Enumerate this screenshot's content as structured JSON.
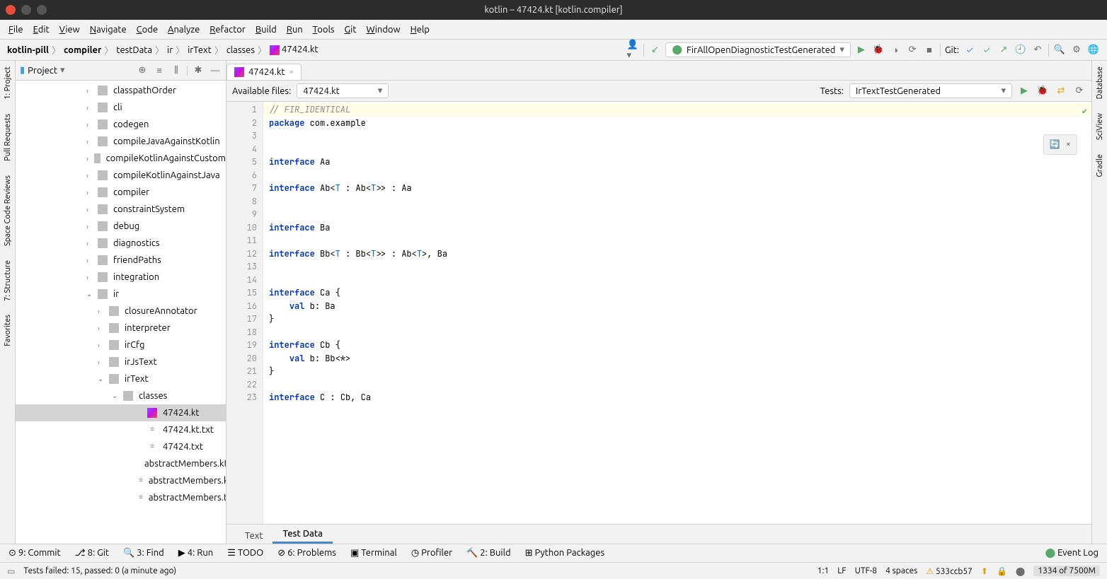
{
  "window": {
    "title": "kotlin – 47424.kt [kotlin.compiler]"
  },
  "menu": [
    "File",
    "Edit",
    "View",
    "Navigate",
    "Code",
    "Analyze",
    "Refactor",
    "Build",
    "Run",
    "Tools",
    "Git",
    "Window",
    "Help"
  ],
  "breadcrumbs": [
    "kotlin-pill",
    "compiler",
    "testData",
    "ir",
    "irText",
    "classes",
    "47424.kt"
  ],
  "run_config": "FirAllOpenDiagnosticTestGenerated",
  "git_label": "Git:",
  "left_tools": [
    {
      "label": "1: Project",
      "icon": "project-icon"
    },
    {
      "label": "Pull Requests",
      "icon": "pr-icon"
    },
    {
      "label": "Space Code Reviews",
      "icon": "space-icon"
    },
    {
      "label": "7: Structure",
      "icon": "structure-icon"
    },
    {
      "label": "Favorites",
      "icon": "star-icon"
    }
  ],
  "right_tools": [
    {
      "label": "Database",
      "icon": "database-icon"
    },
    {
      "label": "SciView",
      "icon": "sciview-icon"
    },
    {
      "label": "Gradle",
      "icon": "gradle-icon"
    }
  ],
  "project_tree": {
    "title": "Project",
    "items": [
      {
        "label": "classpathOrder",
        "indent": 1,
        "chev": "›",
        "icon": "folder"
      },
      {
        "label": "cli",
        "indent": 1,
        "chev": "›",
        "icon": "folder"
      },
      {
        "label": "codegen",
        "indent": 1,
        "chev": "›",
        "icon": "folder"
      },
      {
        "label": "compileJavaAgainstKotlin",
        "indent": 1,
        "chev": "›",
        "icon": "folder"
      },
      {
        "label": "compileKotlinAgainstCustom",
        "indent": 1,
        "chev": "›",
        "icon": "folder"
      },
      {
        "label": "compileKotlinAgainstJava",
        "indent": 1,
        "chev": "›",
        "icon": "folder"
      },
      {
        "label": "compiler",
        "indent": 1,
        "chev": "›",
        "icon": "folder"
      },
      {
        "label": "constraintSystem",
        "indent": 1,
        "chev": "›",
        "icon": "folder"
      },
      {
        "label": "debug",
        "indent": 1,
        "chev": "›",
        "icon": "folder"
      },
      {
        "label": "diagnostics",
        "indent": 1,
        "chev": "›",
        "icon": "folder"
      },
      {
        "label": "friendPaths",
        "indent": 1,
        "chev": "›",
        "icon": "folder"
      },
      {
        "label": "integration",
        "indent": 1,
        "chev": "›",
        "icon": "folder"
      },
      {
        "label": "ir",
        "indent": 1,
        "chev": "⌄",
        "icon": "folder"
      },
      {
        "label": "closureAnnotator",
        "indent": 2,
        "chev": "›",
        "icon": "folder"
      },
      {
        "label": "interpreter",
        "indent": 2,
        "chev": "›",
        "icon": "folder"
      },
      {
        "label": "irCfg",
        "indent": 2,
        "chev": "›",
        "icon": "folder"
      },
      {
        "label": "irJsText",
        "indent": 2,
        "chev": "›",
        "icon": "folder"
      },
      {
        "label": "irText",
        "indent": 2,
        "chev": "⌄",
        "icon": "folder"
      },
      {
        "label": "classes",
        "indent": 3,
        "chev": "⌄",
        "icon": "folder"
      },
      {
        "label": "47424.kt",
        "indent": 5,
        "chev": "",
        "icon": "kt",
        "selected": true
      },
      {
        "label": "47424.kt.txt",
        "indent": 5,
        "chev": "",
        "icon": "txt"
      },
      {
        "label": "47424.txt",
        "indent": 5,
        "chev": "",
        "icon": "txt"
      },
      {
        "label": "abstractMembers.kt",
        "indent": 5,
        "chev": "",
        "icon": "kt"
      },
      {
        "label": "abstractMembers.kt.",
        "indent": 5,
        "chev": "",
        "icon": "txt"
      },
      {
        "label": "abstractMembers.tx",
        "indent": 5,
        "chev": "",
        "icon": "txt"
      }
    ]
  },
  "editor": {
    "tab_label": "47424.kt",
    "available_label": "Available files:",
    "available_value": "47424.kt",
    "tests_label": "Tests:",
    "tests_value": "IrTextTestGenerated",
    "lines": [
      {
        "n": 1,
        "segs": [
          {
            "t": "// FIR_IDENTICAL",
            "c": "comment"
          }
        ],
        "hl": true
      },
      {
        "n": 2,
        "segs": [
          {
            "t": "package",
            "c": "kw"
          },
          {
            "t": " com.example"
          }
        ]
      },
      {
        "n": 3,
        "segs": []
      },
      {
        "n": 4,
        "segs": []
      },
      {
        "n": 5,
        "segs": [
          {
            "t": "interface",
            "c": "kw"
          },
          {
            "t": " Aa"
          }
        ]
      },
      {
        "n": 6,
        "segs": []
      },
      {
        "n": 7,
        "segs": [
          {
            "t": "interface",
            "c": "kw"
          },
          {
            "t": " Ab<"
          },
          {
            "t": "T",
            "c": "typ"
          },
          {
            "t": " : Ab<"
          },
          {
            "t": "T",
            "c": "typ"
          },
          {
            "t": ">> : Aa"
          }
        ]
      },
      {
        "n": 8,
        "segs": []
      },
      {
        "n": 9,
        "segs": []
      },
      {
        "n": 10,
        "segs": [
          {
            "t": "interface",
            "c": "kw"
          },
          {
            "t": " Ba"
          }
        ]
      },
      {
        "n": 11,
        "segs": []
      },
      {
        "n": 12,
        "segs": [
          {
            "t": "interface",
            "c": "kw"
          },
          {
            "t": " Bb<"
          },
          {
            "t": "T",
            "c": "typ"
          },
          {
            "t": " : Bb<"
          },
          {
            "t": "T",
            "c": "typ"
          },
          {
            "t": ">> : Ab<"
          },
          {
            "t": "T",
            "c": "typ"
          },
          {
            "t": ">, Ba"
          }
        ]
      },
      {
        "n": 13,
        "segs": []
      },
      {
        "n": 14,
        "segs": []
      },
      {
        "n": 15,
        "segs": [
          {
            "t": "interface",
            "c": "kw"
          },
          {
            "t": " Ca {"
          }
        ]
      },
      {
        "n": 16,
        "segs": [
          {
            "t": "    "
          },
          {
            "t": "val",
            "c": "kw"
          },
          {
            "t": " b: Ba"
          }
        ]
      },
      {
        "n": 17,
        "segs": [
          {
            "t": "}"
          }
        ]
      },
      {
        "n": 18,
        "segs": []
      },
      {
        "n": 19,
        "segs": [
          {
            "t": "interface",
            "c": "kw"
          },
          {
            "t": " Cb {"
          }
        ]
      },
      {
        "n": 20,
        "segs": [
          {
            "t": "    "
          },
          {
            "t": "val",
            "c": "kw"
          },
          {
            "t": " b: Bb<*>"
          }
        ]
      },
      {
        "n": 21,
        "segs": [
          {
            "t": "}"
          }
        ]
      },
      {
        "n": 22,
        "segs": []
      },
      {
        "n": 23,
        "segs": [
          {
            "t": "interface",
            "c": "kw"
          },
          {
            "t": " C : Cb, Ca"
          }
        ]
      }
    ],
    "bottom_tabs": [
      "Text",
      "Test Data"
    ],
    "active_bottom_tab": "Test Data"
  },
  "bottom_tools": [
    "9: Commit",
    "8: Git",
    "3: Find",
    "4: Run",
    "TODO",
    "6: Problems",
    "Terminal",
    "Profiler",
    "2: Build",
    "Python Packages"
  ],
  "event_log": "Event Log",
  "status": {
    "message": "Tests failed: 15, passed: 0 (a minute ago)",
    "pos": "1:1",
    "eol": "LF",
    "enc": "UTF-8",
    "indent": "4 spaces",
    "branch": "533ccb57",
    "mem": "1334 of 7500M"
  }
}
